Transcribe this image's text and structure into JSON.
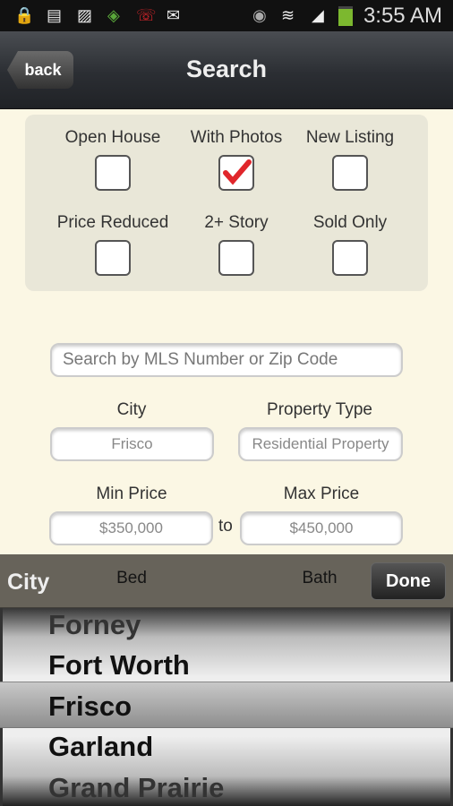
{
  "status_bar": {
    "time": "3:55 AM",
    "icons": [
      "lock-warning-icon",
      "sd-card-icon",
      "image-icon",
      "shield-wifi-icon",
      "wifi-call-icon",
      "gmail-icon",
      "eye-icon",
      "wifi-icon",
      "signal-icon",
      "battery-icon"
    ],
    "battery_color": "#7cb82f"
  },
  "header": {
    "back_label": "back",
    "title": "Search"
  },
  "filters": [
    {
      "label": "Open House",
      "checked": false
    },
    {
      "label": "With Photos",
      "checked": true
    },
    {
      "label": "New Listing",
      "checked": false
    },
    {
      "label": "Price Reduced",
      "checked": false
    },
    {
      "label": "2+ Story",
      "checked": false
    },
    {
      "label": "Sold Only",
      "checked": false
    }
  ],
  "search": {
    "placeholder": "Search by MLS Number or Zip Code"
  },
  "city": {
    "label": "City",
    "value": "Frisco"
  },
  "property_type": {
    "label": "Property Type",
    "value": "Residential Property"
  },
  "min_price": {
    "label": "Min Price",
    "value": "$350,000"
  },
  "to_label": "to",
  "max_price": {
    "label": "Max Price",
    "value": "$450,000"
  },
  "bed": {
    "label": "Bed"
  },
  "bath": {
    "label": "Bath"
  },
  "picker": {
    "title": "City",
    "done_label": "Done",
    "options": [
      "Forney",
      "Fort Worth",
      "Frisco",
      "Garland",
      "Grand Prairie"
    ],
    "selected": "Frisco"
  },
  "check_color": "#e0262b"
}
